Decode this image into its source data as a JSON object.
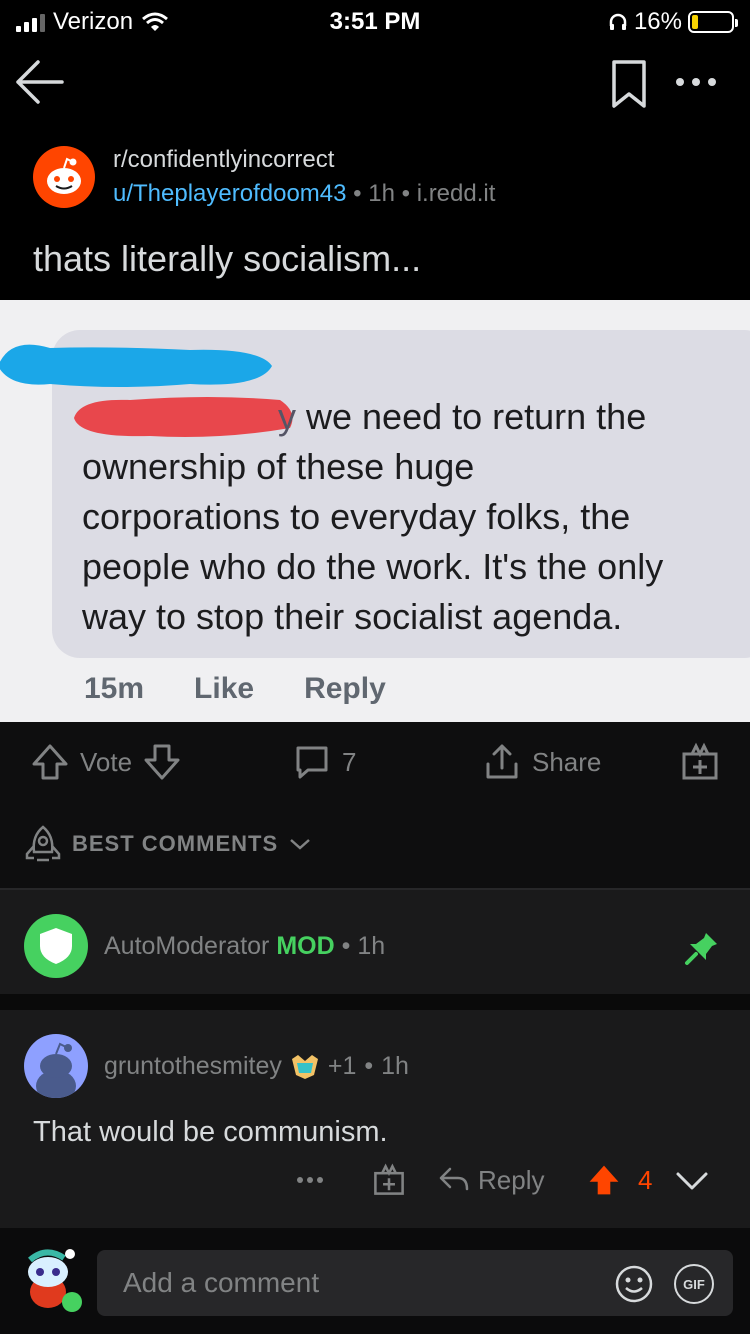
{
  "status_bar": {
    "carrier": "Verizon",
    "time": "3:51 PM",
    "battery": "16%",
    "battery_level": 0.16
  },
  "nav": {
    "back_icon": "back-arrow-icon",
    "bookmark_icon": "bookmark-icon",
    "more_icon": "more-icon"
  },
  "post": {
    "subreddit": "r/confidentlyincorrect",
    "author": "u/Theplayerofdoom43",
    "time": "1h",
    "domain": "i.redd.it",
    "title": "thats literally socialism..."
  },
  "image": {
    "y_fragment": "y",
    "line1": " we need to return the",
    "line2": "ownership of these huge",
    "line3": "corporations to everyday folks, the",
    "line4": "people who do the work. It's the only",
    "line5": "way to stop their socialist agenda.",
    "fb_time": "15m",
    "fb_like": "Like",
    "fb_reply": "Reply",
    "redaction_blue": "#1ba7e8",
    "redaction_red": "#e8474c"
  },
  "actions": {
    "vote_label": "Vote",
    "comment_count": "7",
    "share_label": "Share"
  },
  "sort": {
    "label": "BEST COMMENTS"
  },
  "automod": {
    "name": "AutoModerator",
    "badge": "MOD",
    "time": "1h"
  },
  "comment": {
    "username": "gruntothesmitey",
    "award_count": "+1",
    "time": "1h",
    "body": "That would be communism.",
    "reply_label": "Reply",
    "score": "4"
  },
  "composer": {
    "placeholder": "Add a comment",
    "gif_label": "GIF"
  },
  "colors": {
    "upvote": "#ff4500",
    "mod": "#46d160",
    "link": "#4fbcff",
    "background": "#1a1a1b"
  }
}
